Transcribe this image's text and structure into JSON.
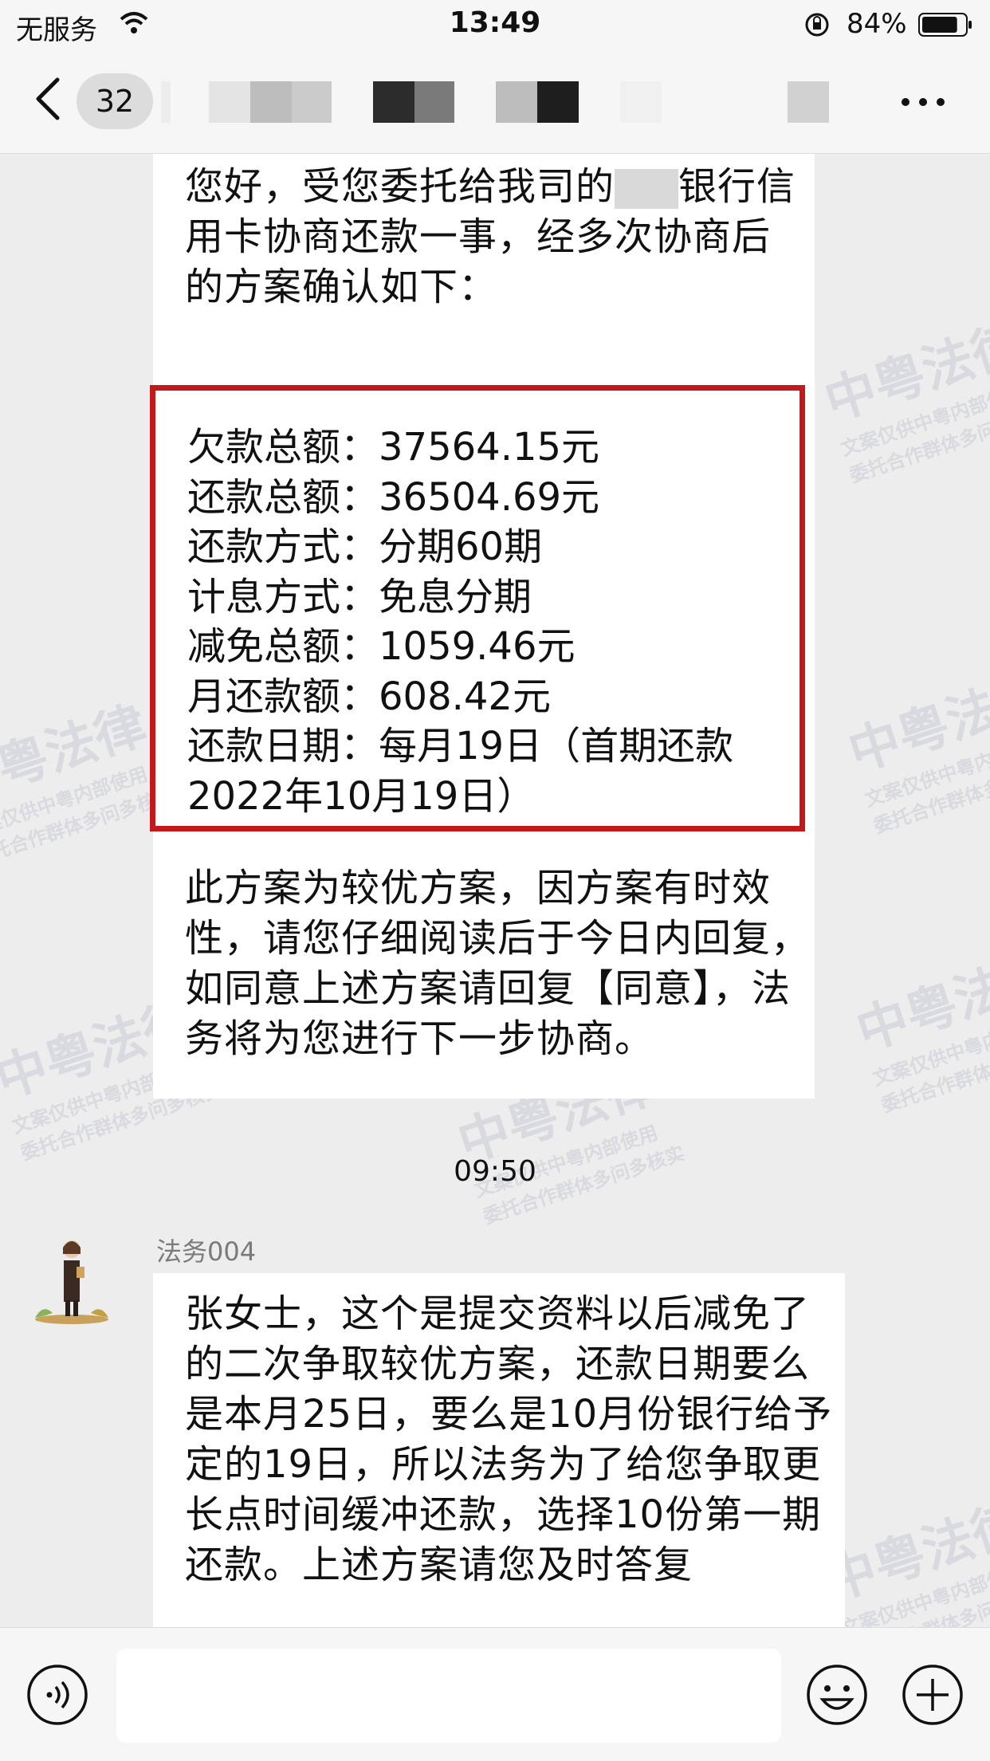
{
  "status_bar": {
    "carrier": "无服务",
    "time": "13:49",
    "battery_percent": "84%",
    "battery_level": 0.84
  },
  "nav": {
    "unread_count": "32"
  },
  "messages": {
    "intro": {
      "part1": "您好，受您委托给我司的",
      "part2": "银行信用卡协商还款一事，经多次协商后的方案确认如下："
    },
    "plan": [
      {
        "label": "欠款总额：",
        "value": "37564.15元"
      },
      {
        "label": "还款总额：",
        "value": "36504.69元"
      },
      {
        "label": "还款方式：",
        "value": "分期60期"
      },
      {
        "label": "计息方式：",
        "value": "免息分期"
      },
      {
        "label": "减免总额：",
        "value": "1059.46元"
      },
      {
        "label": "月还款额：",
        "value": "608.42元"
      },
      {
        "label": "还款日期：",
        "value": "每月19日（首期还款2022年10月19日）"
      }
    ],
    "outro": "此方案为较优方案，因方案有时效性，请您仔细阅读后于今日内回复，如同意上述方案请回复【同意】，法务将为您进行下一步协商。",
    "timestamp": "09:50",
    "sender": "法务004",
    "second_message": "张女士，这个是提交资料以后减免了的二次争取较优方案，还款日期要么是本月25日，要么是10月份银行给予定的19日，所以法务为了给您争取更长点时间缓冲还款，选择10份第一期还款。上述方案请您及时答复"
  },
  "watermark": {
    "main": "中粤法律",
    "line1": "文案仅供中粤内部使用",
    "line2": "委托合作群体多问多核实"
  },
  "input_bar": {
    "placeholder": ""
  }
}
